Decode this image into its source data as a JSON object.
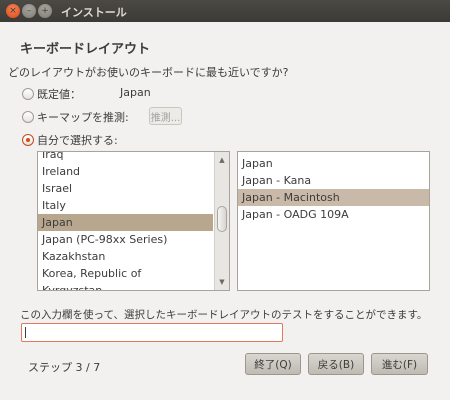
{
  "window": {
    "title": "インストール",
    "close_glyph": "×",
    "minimize_glyph": "–",
    "maximize_glyph": "+"
  },
  "heading": "キーボードレイアウト",
  "subtitle": "どのレイアウトがお使いのキーボードに最も近いですか?",
  "options": {
    "default_label": "既定値：",
    "default_value": "Japan",
    "guess_label": "キーマップを推測:",
    "guess_button": "推測...",
    "manual_label": "自分で選択する:",
    "selected": "manual"
  },
  "layouts": {
    "items": [
      "Iraq",
      "Ireland",
      "Israel",
      "Italy",
      "Japan",
      "Japan (PC-98xx Series)",
      "Kazakhstan",
      "Korea, Republic of",
      "Kyrgyzstan"
    ],
    "selected": "Japan"
  },
  "variants": {
    "items": [
      "Japan",
      "Japan - Kana",
      "Japan - Macintosh",
      "Japan - OADG 109A"
    ],
    "selected": "Japan - Macintosh"
  },
  "test": {
    "caption": "この入力欄を使って、選択したキーボードレイアウトのテストをすることができます。",
    "value": ""
  },
  "footer": {
    "step": "ステップ 3 / 7",
    "quit": "終了(Q)",
    "back": "戻る(B)",
    "next": "進む(F)"
  },
  "colors": {
    "accent": "#dd4814",
    "selection": "#c9b9a8",
    "titlebar": "#3c3b37"
  }
}
